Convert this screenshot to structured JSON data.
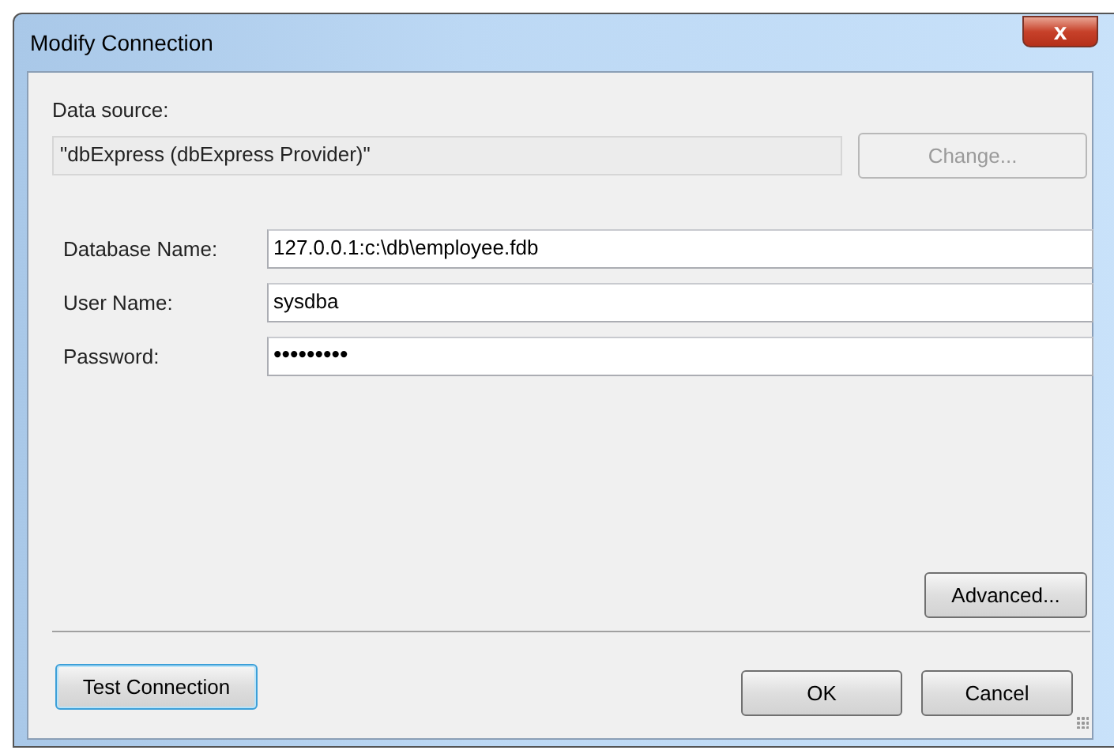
{
  "window": {
    "title": "Modify Connection",
    "close": "x"
  },
  "data_source": {
    "label": "Data source:",
    "value": "\"dbExpress (dbExpress Provider)\"",
    "button": {
      "label": "Change...",
      "disabled": true,
      "focused": false
    }
  },
  "fields": [
    {
      "label": "Database Name:",
      "value": "127.0.0.1:c:\\db\\employee.fdb",
      "kind": "text"
    },
    {
      "label": "User Name:",
      "value": "sysdba",
      "kind": "text"
    },
    {
      "label": "Password:",
      "value": "•••••••••",
      "kind": "password"
    }
  ],
  "advanced_button": {
    "label": "Advanced...",
    "disabled": false,
    "focused": false
  },
  "footer_buttons": [
    {
      "label": "Test Connection",
      "disabled": false,
      "focused": true
    },
    {
      "label": "OK",
      "disabled": false,
      "focused": false
    },
    {
      "label": "Cancel",
      "disabled": false,
      "focused": false
    }
  ]
}
